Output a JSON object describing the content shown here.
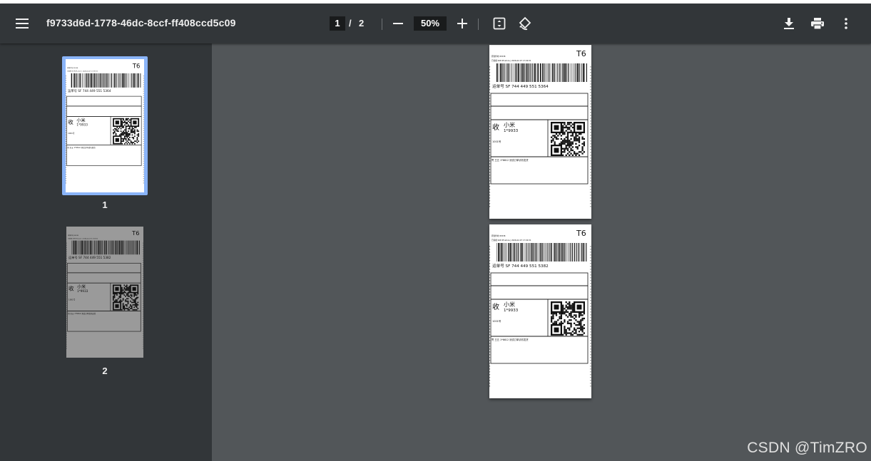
{
  "toolbar": {
    "title": "f9733d6d-1778-46dc-8ccf-ff408ccd5c09",
    "current_page": "1",
    "page_separator": "/",
    "total_pages": "2",
    "zoom": "50%",
    "icons": [
      "menu-icon",
      "zoom-out-icon",
      "zoom-in-icon",
      "fit-page-icon",
      "rotate-icon",
      "download-icon",
      "print-icon",
      "more-icon"
    ]
  },
  "thumbnails": [
    {
      "number": "1",
      "selected": true
    },
    {
      "number": "2",
      "selected": false
    }
  ],
  "labels": [
    {
      "code": "T6",
      "header_line1": "原寄件地 95338",
      "header_line2": "已验视      SOP-P3-store | 2026-02-07 17:09:31",
      "tracking_prefix": "运单号",
      "tracking_number": "SF 744 449 551 5364",
      "receiver_mark": "收",
      "receiver_name": "小米",
      "receiver_phone": "1*9933",
      "receiver_address": "1001号",
      "sender_mark": "寄",
      "sender_name": "王五",
      "sender_phone": "1*6612",
      "sender_note": "测试订单请勿发货"
    },
    {
      "code": "T6",
      "header_line1": "原寄件地 95338",
      "header_line2": "已验视      SOP-P3-store | 2026-02-07 17:09:31",
      "tracking_prefix": "运单号",
      "tracking_number": "SF 744 449 551 5382",
      "receiver_mark": "收",
      "receiver_name": "小米",
      "receiver_phone": "1*9933",
      "receiver_address": "1001号",
      "sender_mark": "寄",
      "sender_name": "王五",
      "sender_phone": "1*6612",
      "sender_note": "测试订单请勿发货"
    }
  ],
  "watermark": "CSDN @TimZRO",
  "colors": {
    "toolbar": "#323639",
    "sidebar": "#323639",
    "viewer": "#525659",
    "selected_thumb_border": "#8ab4f8"
  }
}
